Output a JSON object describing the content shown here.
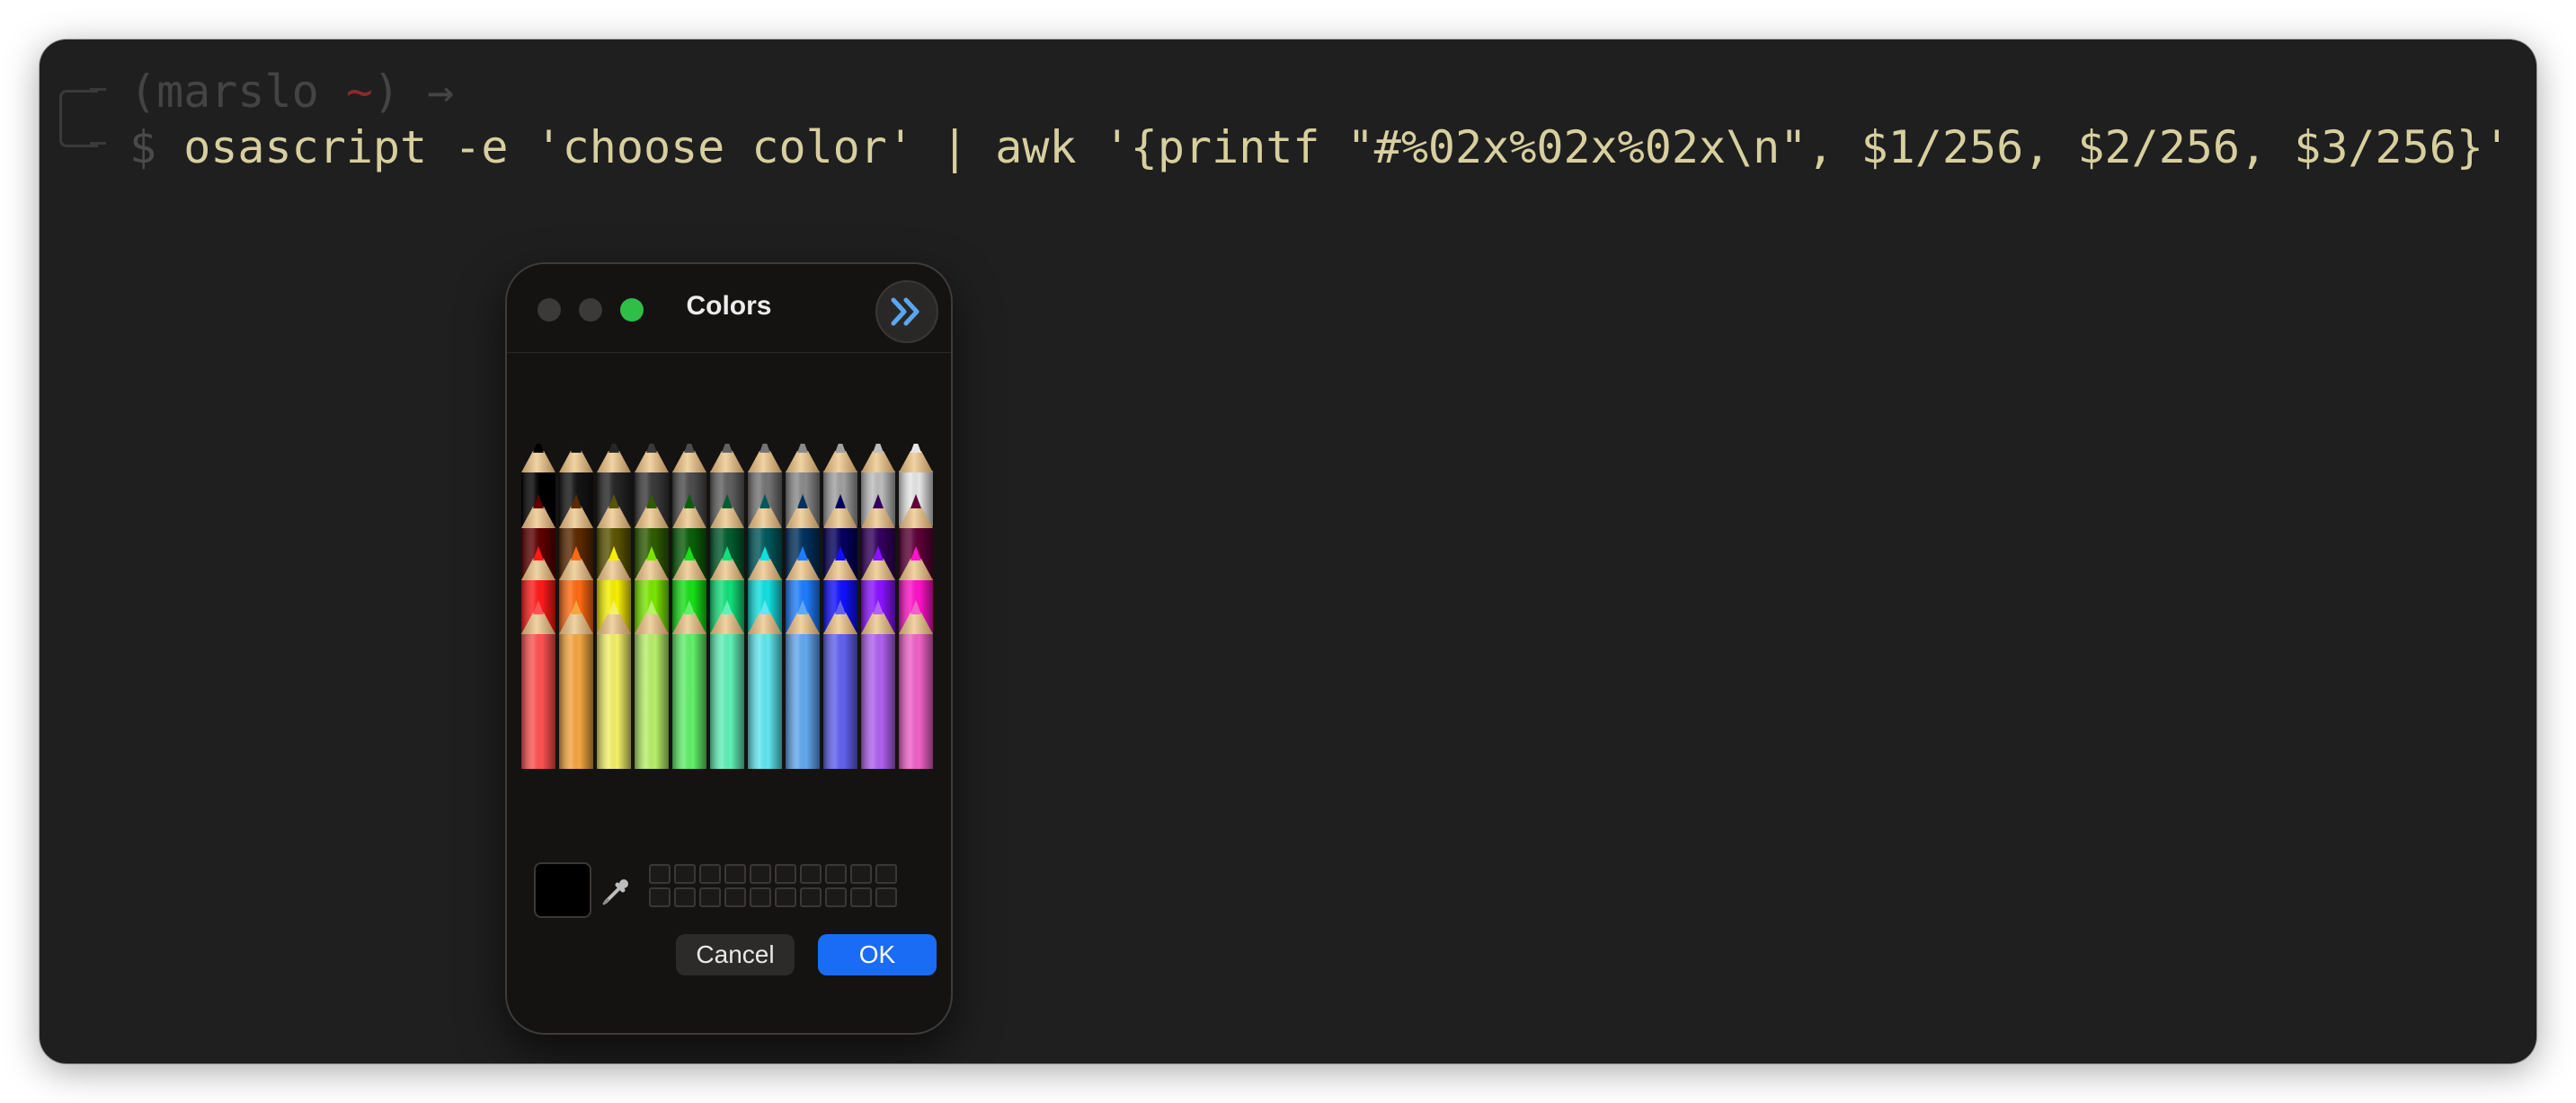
{
  "terminal": {
    "prompt_open": "(marslo ",
    "prompt_tilde": "~",
    "prompt_close": ") →",
    "dollar": "$",
    "command": "osascript -e 'choose color' | awk '{printf \"#%02x%02x%02x\\n\", $1/256, $2/256, $3/256}'"
  },
  "panel": {
    "title": "Colors",
    "cancel_label": "Cancel",
    "ok_label": "OK",
    "selected_color": "#000000",
    "accent": "#1a6cf5",
    "pencil_rows": [
      [
        "#000000",
        "#141414",
        "#262626",
        "#3a3a3a",
        "#4d4d4d",
        "#616161",
        "#757575",
        "#8a8a8a",
        "#a0a0a0",
        "#bdbdbd",
        "#e6e6e6"
      ],
      [
        "#5e0000",
        "#5c2a00",
        "#5a5400",
        "#2e5c00",
        "#0a5e0a",
        "#005c2e",
        "#00585c",
        "#00305e",
        "#04005e",
        "#34005e",
        "#5e0038"
      ],
      [
        "#ff1a1a",
        "#ff6a13",
        "#f7f000",
        "#7ae600",
        "#18e018",
        "#12e07a",
        "#12e0e0",
        "#1e7dff",
        "#1010ff",
        "#8a12ff",
        "#ff12c8"
      ],
      [
        "#ff5252",
        "#f4a642",
        "#f4f06a",
        "#b8f06a",
        "#62f06a",
        "#62f0b8",
        "#62e6f0",
        "#62a8f0",
        "#6262f0",
        "#b062f0",
        "#f062c8"
      ]
    ],
    "icons": {
      "toolbar": "chevron-double-right-icon",
      "eyedropper": "eyedropper-icon"
    }
  }
}
